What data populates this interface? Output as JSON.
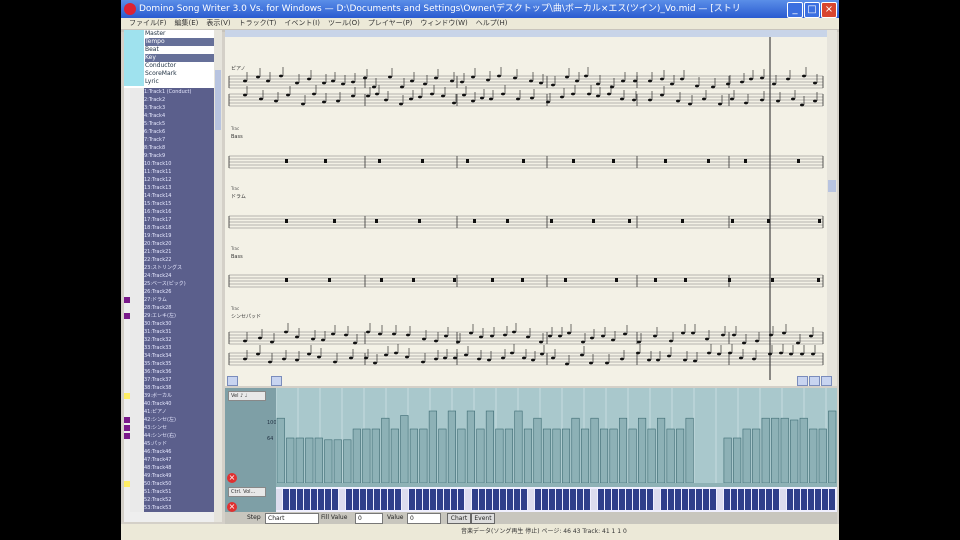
{
  "window": {
    "title": "Domino Song Writer 3.0 Vs. for Windows — D:\\Documents and Settings\\Owner\\デスクトップ\\曲\\ボーカル×エス(ツイン)_Vo.mid — [ストリングス_for...]",
    "minimize": "_",
    "maximize": "□",
    "close": "×"
  },
  "menu": [
    "ファイル(F)",
    "編集(E)",
    "表示(V)",
    "トラック(T)",
    "イベント(I)",
    "ツール(O)",
    "プレイヤー(P)",
    "ウィンドウ(W)",
    "ヘルプ(H)"
  ],
  "sidebar": {
    "top_items": [
      {
        "label": "Master",
        "selected": false
      },
      {
        "label": "Tempo",
        "selected": true
      },
      {
        "label": "Beat",
        "selected": false
      },
      {
        "label": "Key",
        "selected": true
      },
      {
        "label": "Conductor",
        "selected": false
      },
      {
        "label": "ScoreMark",
        "selected": false
      },
      {
        "label": "Lyric",
        "selected": false
      }
    ],
    "tracks": [
      {
        "name": "1:Track1 (Conduct)",
        "mark": ""
      },
      {
        "name": "2:Track2",
        "mark": ""
      },
      {
        "name": "3:Track3",
        "mark": ""
      },
      {
        "name": "4:Track4",
        "mark": ""
      },
      {
        "name": "5:Track5",
        "mark": ""
      },
      {
        "name": "6:Track6",
        "mark": ""
      },
      {
        "name": "7:Track7",
        "mark": ""
      },
      {
        "name": "8:Track8",
        "mark": ""
      },
      {
        "name": "9:Track9",
        "mark": ""
      },
      {
        "name": "10:Track10",
        "mark": ""
      },
      {
        "name": "11:Track11",
        "mark": ""
      },
      {
        "name": "12:Track12",
        "mark": ""
      },
      {
        "name": "13:Track13",
        "mark": ""
      },
      {
        "name": "14:Track14",
        "mark": ""
      },
      {
        "name": "15:Track15",
        "mark": ""
      },
      {
        "name": "16:Track16",
        "mark": ""
      },
      {
        "name": "17:Track17",
        "mark": ""
      },
      {
        "name": "18:Track18",
        "mark": ""
      },
      {
        "name": "19:Track19",
        "mark": ""
      },
      {
        "name": "20:Track20",
        "mark": ""
      },
      {
        "name": "21:Track21",
        "mark": ""
      },
      {
        "name": "22:Track22",
        "mark": ""
      },
      {
        "name": "23:ストリングス",
        "mark": ""
      },
      {
        "name": "24:Track24",
        "mark": ""
      },
      {
        "name": "25:ベース(ピック)",
        "mark": ""
      },
      {
        "name": "26:Track26",
        "mark": ""
      },
      {
        "name": "27:ドラム",
        "mark": "#7a1a8a"
      },
      {
        "name": "28:Track28",
        "mark": ""
      },
      {
        "name": "29:エレキ(左)",
        "mark": "#7a1a8a"
      },
      {
        "name": "30:Track30",
        "mark": ""
      },
      {
        "name": "31:Track31",
        "mark": ""
      },
      {
        "name": "32:Track32",
        "mark": ""
      },
      {
        "name": "33:Track33",
        "mark": ""
      },
      {
        "name": "34:Track34",
        "mark": ""
      },
      {
        "name": "35:Track35",
        "mark": ""
      },
      {
        "name": "36:Track36",
        "mark": ""
      },
      {
        "name": "37:Track37",
        "mark": ""
      },
      {
        "name": "38:Track38",
        "mark": ""
      },
      {
        "name": "39:ボーカル",
        "mark": "#ffee66"
      },
      {
        "name": "40:Track40",
        "mark": ""
      },
      {
        "name": "41:ピアノ",
        "mark": ""
      },
      {
        "name": "42:シンセ(左)",
        "mark": "#7a1a8a"
      },
      {
        "name": "43:シンセ",
        "mark": "#7a1a8a"
      },
      {
        "name": "44:シンセ(右)",
        "mark": "#7a1a8a"
      },
      {
        "name": "45:パッド",
        "mark": ""
      },
      {
        "name": "46:Track46",
        "mark": ""
      },
      {
        "name": "47:Track47",
        "mark": ""
      },
      {
        "name": "48:Track48",
        "mark": ""
      },
      {
        "name": "49:Track49",
        "mark": ""
      },
      {
        "name": "50:Track50",
        "mark": "#ffee66"
      },
      {
        "name": "51:Track51",
        "mark": ""
      },
      {
        "name": "52:Track52",
        "mark": ""
      },
      {
        "name": "53:Track53",
        "mark": ""
      }
    ]
  },
  "score": {
    "staff_labels": [
      "ピアノ",
      "Bass",
      "ドラム",
      "Bass",
      "シンセパッド"
    ],
    "small_labels": [
      "Trac",
      "Trac",
      "Trac",
      "Trac"
    ]
  },
  "velocity": {
    "label": "Vel ♪ ♩",
    "scale_top": "100",
    "scale_mid": "64",
    "bars": [
      72,
      50,
      50,
      50,
      50,
      48,
      48,
      48,
      60,
      60,
      60,
      72,
      60,
      75,
      60,
      60,
      80,
      60,
      80,
      60,
      80,
      60,
      80,
      60,
      60,
      80,
      60,
      72,
      60,
      60,
      60,
      72,
      60,
      72,
      60,
      60,
      72,
      60,
      72,
      60,
      72,
      60,
      60,
      72,
      0,
      0,
      0,
      50,
      50,
      60,
      60,
      72,
      72,
      72,
      70,
      72,
      60,
      60,
      80
    ]
  },
  "pitch_label": "Ctrl. Vol...",
  "controls": {
    "step_label": "Step",
    "step_value": "Chart",
    "entry_label": "Fill Value",
    "entry_value": "0",
    "value_label": "Value",
    "value_value": "0",
    "chart_btn": "Chart",
    "event_btn": "Event"
  },
  "status": "音楽データ(ソング再生 停止) ページ: 46  43    Track: 41  1  1  0"
}
